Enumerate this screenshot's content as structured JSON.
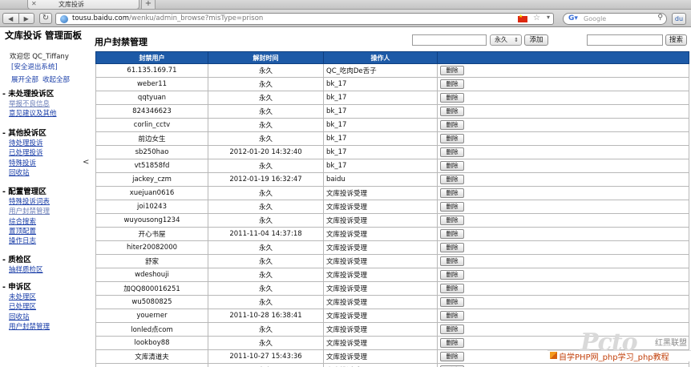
{
  "browser": {
    "tab_title": "文库投诉",
    "url_host": "tousu.baidu.com",
    "url_path": "/wenku/admin_browse?misType=prison",
    "search_engine": "Google"
  },
  "sidebar": {
    "title": "文库投诉 管理面板",
    "welcome": "欢迎您 QC_Tiffany",
    "logout": "[安全退出系统]",
    "expand_all": "展开全部",
    "collapse_all": "收起全部",
    "sections": [
      {
        "heading": "- 未处理投诉区",
        "items": [
          "举报不良信息",
          "意见建议及其他"
        ]
      },
      {
        "heading": "- 其他投诉区",
        "items": [
          "待处理投诉",
          "已处理投诉",
          "特殊投诉",
          "回收站"
        ]
      },
      {
        "heading": "- 配置管理区",
        "items": [
          "特殊投诉词表",
          "用户封禁管理",
          "综合搜索",
          "置顶配置",
          "操作日志"
        ]
      },
      {
        "heading": "- 质检区",
        "items": [
          "抽样质检区"
        ]
      },
      {
        "heading": "- 申诉区",
        "items": [
          "未处理区",
          "已处理区",
          "回收站",
          "用户封禁管理"
        ]
      }
    ]
  },
  "main": {
    "page_title": "用户封禁管理",
    "duration_selected": "永久",
    "add_label": "添加",
    "search_label": "搜索",
    "columns": [
      "封禁用户",
      "解封时间",
      "操作人",
      ""
    ],
    "delete_label": "删除",
    "rows": [
      {
        "user": "61.135.169.71",
        "time": "永久",
        "op": "QC_吃肉De舌子"
      },
      {
        "user": "weber11",
        "time": "永久",
        "op": "bk_17"
      },
      {
        "user": "qqtyuan",
        "time": "永久",
        "op": "bk_17"
      },
      {
        "user": "824346623",
        "time": "永久",
        "op": "bk_17"
      },
      {
        "user": "corlin_cctv",
        "time": "永久",
        "op": "bk_17"
      },
      {
        "user": "前边女生",
        "time": "永久",
        "op": "bk_17"
      },
      {
        "user": "sb250hao",
        "time": "2012-01-20 14:32:40",
        "op": "bk_17"
      },
      {
        "user": "vt51858fd",
        "time": "永久",
        "op": "bk_17"
      },
      {
        "user": "jackey_czm",
        "time": "2012-01-19 16:32:47",
        "op": "baidu"
      },
      {
        "user": "xuejuan0616",
        "time": "永久",
        "op": "文库投诉受理"
      },
      {
        "user": "joi10243",
        "time": "永久",
        "op": "文库投诉受理"
      },
      {
        "user": "wuyousong1234",
        "time": "永久",
        "op": "文库投诉受理"
      },
      {
        "user": "开心书屋",
        "time": "2011-11-04 14:37:18",
        "op": "文库投诉受理"
      },
      {
        "user": "hiter20082000",
        "time": "永久",
        "op": "文库投诉受理"
      },
      {
        "user": "舒家",
        "time": "永久",
        "op": "文库投诉受理"
      },
      {
        "user": "wdeshouji",
        "time": "永久",
        "op": "文库投诉受理"
      },
      {
        "user": "加QQ800016251",
        "time": "永久",
        "op": "文库投诉受理"
      },
      {
        "user": "wu5080825",
        "time": "永久",
        "op": "文库投诉受理"
      },
      {
        "user": "youerner",
        "time": "2011-10-28 16:38:41",
        "op": "文库投诉受理"
      },
      {
        "user": "lonled点com",
        "time": "永久",
        "op": "文库投诉受理"
      },
      {
        "user": "lookboy88",
        "time": "永久",
        "op": "文库投诉受理"
      },
      {
        "user": "文库清道夫",
        "time": "2011-10-27 15:43:36",
        "op": "文库投诉受理"
      },
      {
        "user": "",
        "time": "永久",
        "op": "文库投诉受理"
      }
    ]
  },
  "watermark": {
    "logo": "Pcto",
    "brand": "红黑联盟",
    "slogan": "自学PHP网_php学习_php教程"
  }
}
